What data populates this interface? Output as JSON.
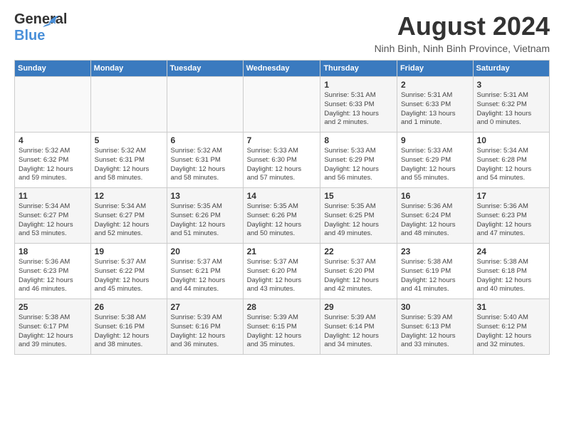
{
  "header": {
    "logo_line1": "General",
    "logo_line2": "Blue",
    "month_year": "August 2024",
    "location": "Ninh Binh, Ninh Binh Province, Vietnam"
  },
  "days_of_week": [
    "Sunday",
    "Monday",
    "Tuesday",
    "Wednesday",
    "Thursday",
    "Friday",
    "Saturday"
  ],
  "weeks": [
    [
      {
        "day": "",
        "info": ""
      },
      {
        "day": "",
        "info": ""
      },
      {
        "day": "",
        "info": ""
      },
      {
        "day": "",
        "info": ""
      },
      {
        "day": "1",
        "info": "Sunrise: 5:31 AM\nSunset: 6:33 PM\nDaylight: 13 hours\nand 2 minutes."
      },
      {
        "day": "2",
        "info": "Sunrise: 5:31 AM\nSunset: 6:33 PM\nDaylight: 13 hours\nand 1 minute."
      },
      {
        "day": "3",
        "info": "Sunrise: 5:31 AM\nSunset: 6:32 PM\nDaylight: 13 hours\nand 0 minutes."
      }
    ],
    [
      {
        "day": "4",
        "info": "Sunrise: 5:32 AM\nSunset: 6:32 PM\nDaylight: 12 hours\nand 59 minutes."
      },
      {
        "day": "5",
        "info": "Sunrise: 5:32 AM\nSunset: 6:31 PM\nDaylight: 12 hours\nand 58 minutes."
      },
      {
        "day": "6",
        "info": "Sunrise: 5:32 AM\nSunset: 6:31 PM\nDaylight: 12 hours\nand 58 minutes."
      },
      {
        "day": "7",
        "info": "Sunrise: 5:33 AM\nSunset: 6:30 PM\nDaylight: 12 hours\nand 57 minutes."
      },
      {
        "day": "8",
        "info": "Sunrise: 5:33 AM\nSunset: 6:29 PM\nDaylight: 12 hours\nand 56 minutes."
      },
      {
        "day": "9",
        "info": "Sunrise: 5:33 AM\nSunset: 6:29 PM\nDaylight: 12 hours\nand 55 minutes."
      },
      {
        "day": "10",
        "info": "Sunrise: 5:34 AM\nSunset: 6:28 PM\nDaylight: 12 hours\nand 54 minutes."
      }
    ],
    [
      {
        "day": "11",
        "info": "Sunrise: 5:34 AM\nSunset: 6:27 PM\nDaylight: 12 hours\nand 53 minutes."
      },
      {
        "day": "12",
        "info": "Sunrise: 5:34 AM\nSunset: 6:27 PM\nDaylight: 12 hours\nand 52 minutes."
      },
      {
        "day": "13",
        "info": "Sunrise: 5:35 AM\nSunset: 6:26 PM\nDaylight: 12 hours\nand 51 minutes."
      },
      {
        "day": "14",
        "info": "Sunrise: 5:35 AM\nSunset: 6:26 PM\nDaylight: 12 hours\nand 50 minutes."
      },
      {
        "day": "15",
        "info": "Sunrise: 5:35 AM\nSunset: 6:25 PM\nDaylight: 12 hours\nand 49 minutes."
      },
      {
        "day": "16",
        "info": "Sunrise: 5:36 AM\nSunset: 6:24 PM\nDaylight: 12 hours\nand 48 minutes."
      },
      {
        "day": "17",
        "info": "Sunrise: 5:36 AM\nSunset: 6:23 PM\nDaylight: 12 hours\nand 47 minutes."
      }
    ],
    [
      {
        "day": "18",
        "info": "Sunrise: 5:36 AM\nSunset: 6:23 PM\nDaylight: 12 hours\nand 46 minutes."
      },
      {
        "day": "19",
        "info": "Sunrise: 5:37 AM\nSunset: 6:22 PM\nDaylight: 12 hours\nand 45 minutes."
      },
      {
        "day": "20",
        "info": "Sunrise: 5:37 AM\nSunset: 6:21 PM\nDaylight: 12 hours\nand 44 minutes."
      },
      {
        "day": "21",
        "info": "Sunrise: 5:37 AM\nSunset: 6:20 PM\nDaylight: 12 hours\nand 43 minutes."
      },
      {
        "day": "22",
        "info": "Sunrise: 5:37 AM\nSunset: 6:20 PM\nDaylight: 12 hours\nand 42 minutes."
      },
      {
        "day": "23",
        "info": "Sunrise: 5:38 AM\nSunset: 6:19 PM\nDaylight: 12 hours\nand 41 minutes."
      },
      {
        "day": "24",
        "info": "Sunrise: 5:38 AM\nSunset: 6:18 PM\nDaylight: 12 hours\nand 40 minutes."
      }
    ],
    [
      {
        "day": "25",
        "info": "Sunrise: 5:38 AM\nSunset: 6:17 PM\nDaylight: 12 hours\nand 39 minutes."
      },
      {
        "day": "26",
        "info": "Sunrise: 5:38 AM\nSunset: 6:16 PM\nDaylight: 12 hours\nand 38 minutes."
      },
      {
        "day": "27",
        "info": "Sunrise: 5:39 AM\nSunset: 6:16 PM\nDaylight: 12 hours\nand 36 minutes."
      },
      {
        "day": "28",
        "info": "Sunrise: 5:39 AM\nSunset: 6:15 PM\nDaylight: 12 hours\nand 35 minutes."
      },
      {
        "day": "29",
        "info": "Sunrise: 5:39 AM\nSunset: 6:14 PM\nDaylight: 12 hours\nand 34 minutes."
      },
      {
        "day": "30",
        "info": "Sunrise: 5:39 AM\nSunset: 6:13 PM\nDaylight: 12 hours\nand 33 minutes."
      },
      {
        "day": "31",
        "info": "Sunrise: 5:40 AM\nSunset: 6:12 PM\nDaylight: 12 hours\nand 32 minutes."
      }
    ]
  ]
}
